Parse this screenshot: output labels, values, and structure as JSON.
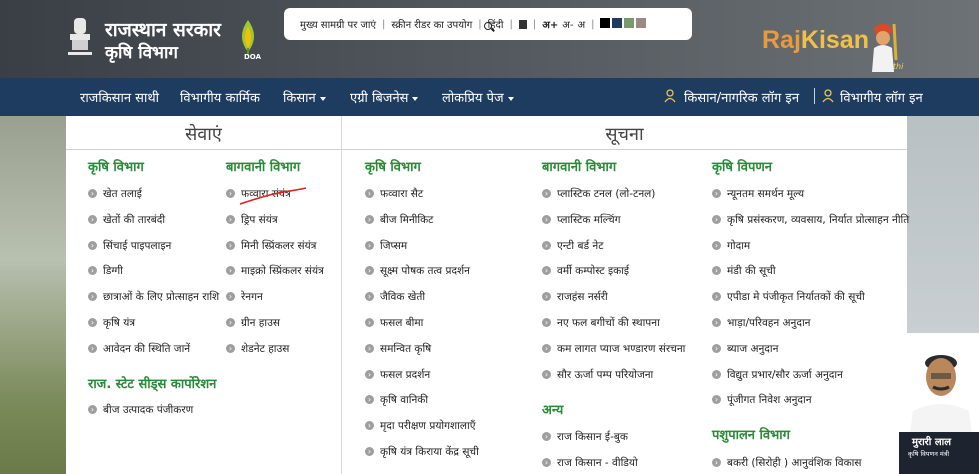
{
  "header": {
    "title_line1": "राजस्थान सरकार",
    "title_line2": "कृषि विभाग",
    "doa_label": "DOA",
    "topbar": {
      "skip_to_main": "मुख्य सामग्री पर जाएं",
      "screen_reader": "स्क्रीन रीडर का उपयोग",
      "hindi": "हिंदी",
      "font_plus": "अ+",
      "font_minus": "अ-",
      "font_normal": "अ",
      "swatches": [
        "#000000",
        "#1f3b62",
        "#7a9a6a",
        "#9a8a84"
      ]
    },
    "logo": {
      "raj": "Raj",
      "kisan": "Kisan",
      "sathi": "Saathi"
    }
  },
  "nav": {
    "items": [
      "राजकिसान साथी",
      "विभागीय कार्मिक",
      "किसान",
      "एग्री बिजनेस",
      "लोकप्रिय पेज"
    ],
    "login_farmer": "किसान/नागरिक लॉग इन",
    "login_dept": "विभागीय लॉग इन"
  },
  "menu": {
    "services_title": "सेवाएं",
    "info_title": "सूचना",
    "services": {
      "agri_heading": "कृषि विभाग",
      "agri_items": [
        "खेत तलाई",
        "खेतों की तारबंदी",
        "सिंचाई पाइपलाइन",
        "डिग्गी",
        "छात्राओं के लिए प्रोत्साहन राशि",
        "कृषि यंत्र",
        "आवेदन की स्थिति जानें"
      ],
      "horti_heading": "बागवानी विभाग",
      "horti_items": [
        "फव्वारा संयंत्र",
        "ड्रिप संयंत्र",
        "मिनी स्प्रिंकलर संयंत्र",
        "माइक्रो स्प्रिंकलर संयंत्र",
        "रेनगन",
        "ग्रीन हाउस",
        "शेडनेट हाउस"
      ],
      "seeds_heading": "राज. स्टेट सीड्स कार्पोरेशन",
      "seeds_items": [
        "बीज उत्पादक पंजीकरण"
      ]
    },
    "info": {
      "agri_heading": "कृषि विभाग",
      "agri_items": [
        "फव्वारा सैट",
        "बीज मिनीकिट",
        "जिप्सम",
        "सूक्ष्म पोषक तत्व प्रदर्शन",
        "जैविक खेती",
        "फसल बीमा",
        "समन्वित कृषि",
        "फसल प्रदर्शन",
        "कृषि वानिकी",
        "मृदा परीक्षण प्रयोगशालाएँ",
        "कृषि यंत्र किराया केंद्र सूची"
      ],
      "horti_heading": "बागवानी विभाग",
      "horti_items": [
        "प्लास्टिक टनल (लो-टनल)",
        "प्लास्टिक मल्चिंग",
        "एन्टी बर्ड नेट",
        "वर्मी कम्पोस्ट इकाई",
        "राजहंस नर्सरी",
        "नए फल बगीचों की स्थापना",
        "कम लागत प्याज भण्डारण संरचना",
        "सौर ऊर्जा पम्प परियोजना"
      ],
      "other_heading": "अन्य",
      "other_items": [
        "राज किसान ई-बुक",
        "राज किसान - वीडियो"
      ],
      "market_heading": "कृषि विपणन",
      "market_items": [
        "न्यूनतम समर्थन मूल्य",
        "कृषि प्रसंस्करण, व्यवसाय, निर्यात प्रोत्साहन नीति",
        "गोदाम",
        "मंडी की सूची",
        "एपीडा मे पंजीकृत निर्यातकों की सूची",
        "भाड़ा/परिवहन अनुदान",
        "ब्याज अनुदान",
        "विद्युत प्रभार/सौर ऊर्जा अनुदान",
        "पूंजीगत निवेश अनुदान"
      ],
      "animal_heading": "पशुपालन विभाग",
      "animal_items": [
        "बकरी (सिरोही ) आनुवंशिक विकास"
      ]
    }
  },
  "minister": {
    "name": "मुरारी लाल",
    "title": "कृषि विपणन मंत्री"
  }
}
